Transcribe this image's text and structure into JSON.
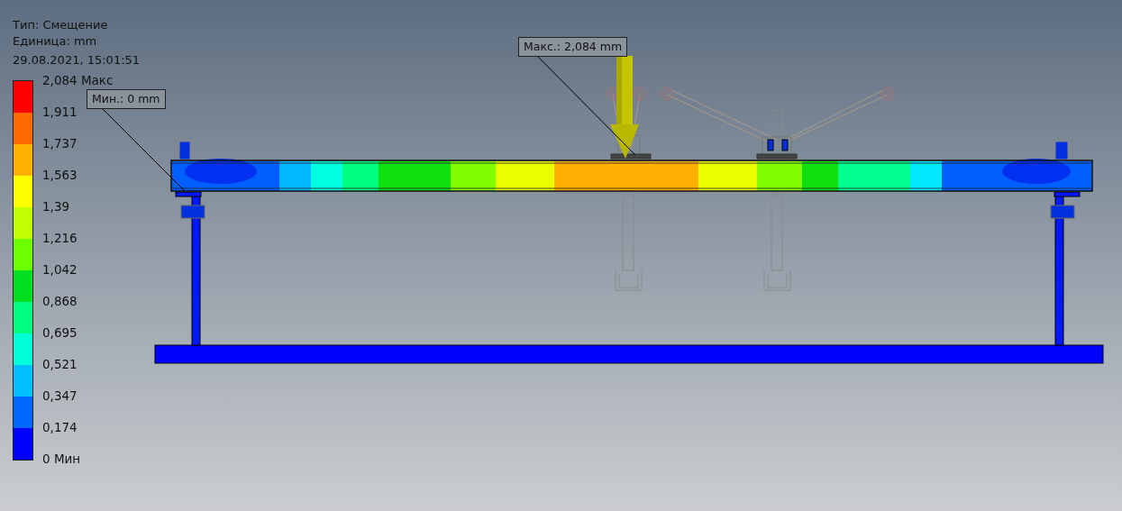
{
  "legend": {
    "type": "Тип: Смещение",
    "unit": "Единица: mm",
    "timestamp": "29.08.2021, 15:01:51",
    "scale_labels": [
      "2,084 Макс",
      "1,911",
      "1,737",
      "1,563",
      "1,39",
      "1,216",
      "1,042",
      "0,868",
      "0,695",
      "0,521",
      "0,347",
      "0,174",
      "0 Мин"
    ],
    "scale_colors": [
      {
        "color": "#ff0000"
      },
      {
        "color": "#ff6a00"
      },
      {
        "color": "#ffb300"
      },
      {
        "color": "#ffff00"
      },
      {
        "color": "#c4ff00"
      },
      {
        "color": "#6cff00"
      },
      {
        "color": "#00e020"
      },
      {
        "color": "#00ff80"
      },
      {
        "color": "#00ffd8"
      },
      {
        "color": "#00c0ff"
      },
      {
        "color": "#0068ff"
      },
      {
        "color": "#0000ff"
      }
    ]
  },
  "callouts": [
    {
      "kind": "min",
      "text": "Мин.: 0 mm"
    },
    {
      "kind": "max",
      "text": "Макс.: 2,084 mm"
    }
  ]
}
